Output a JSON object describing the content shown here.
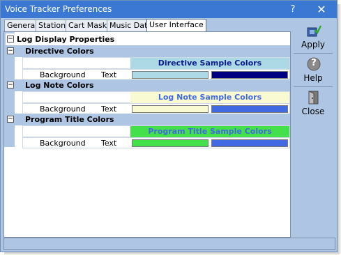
{
  "window": {
    "title": "Voice Tracker Preferences",
    "help_glyph": "?",
    "close_glyph": "✕"
  },
  "tabs": [
    {
      "label": "General"
    },
    {
      "label": "Stations"
    },
    {
      "label": "Cart Masks"
    },
    {
      "label": "Music Data"
    },
    {
      "label": "User Interface",
      "active": true
    }
  ],
  "tree": {
    "root_label": "Log Display Properties",
    "toggle_glyph": "−",
    "groups": [
      {
        "label": "Directive Colors",
        "sample_text": "Directive Sample Colors",
        "sample_fg": "#0a1d8a",
        "sample_bg": "#add8e6",
        "background_label": "Background",
        "text_label": "Text",
        "background_color": "#add8e6",
        "text_color": "#000080"
      },
      {
        "label": "Log Note Colors",
        "sample_text": "Log Note Sample Colors",
        "sample_fg": "#4169e1",
        "sample_bg": "#fafad2",
        "background_label": "Background",
        "text_label": "Text",
        "background_color": "#fafad2",
        "text_color": "#4169e1"
      },
      {
        "label": "Program Title Colors",
        "sample_text": "Program Title Sample Colors",
        "sample_fg": "#4169e1",
        "sample_bg": "#44e04b",
        "background_label": "Background",
        "text_label": "Text",
        "background_color": "#44e04b",
        "text_color": "#4169e1"
      }
    ]
  },
  "sidebar": {
    "apply": {
      "label": "Apply",
      "icon": "apply-icon"
    },
    "help": {
      "label": "Help",
      "icon": "help-icon",
      "glyph": "?"
    },
    "close": {
      "label": "Close",
      "icon": "close-door-icon"
    }
  }
}
